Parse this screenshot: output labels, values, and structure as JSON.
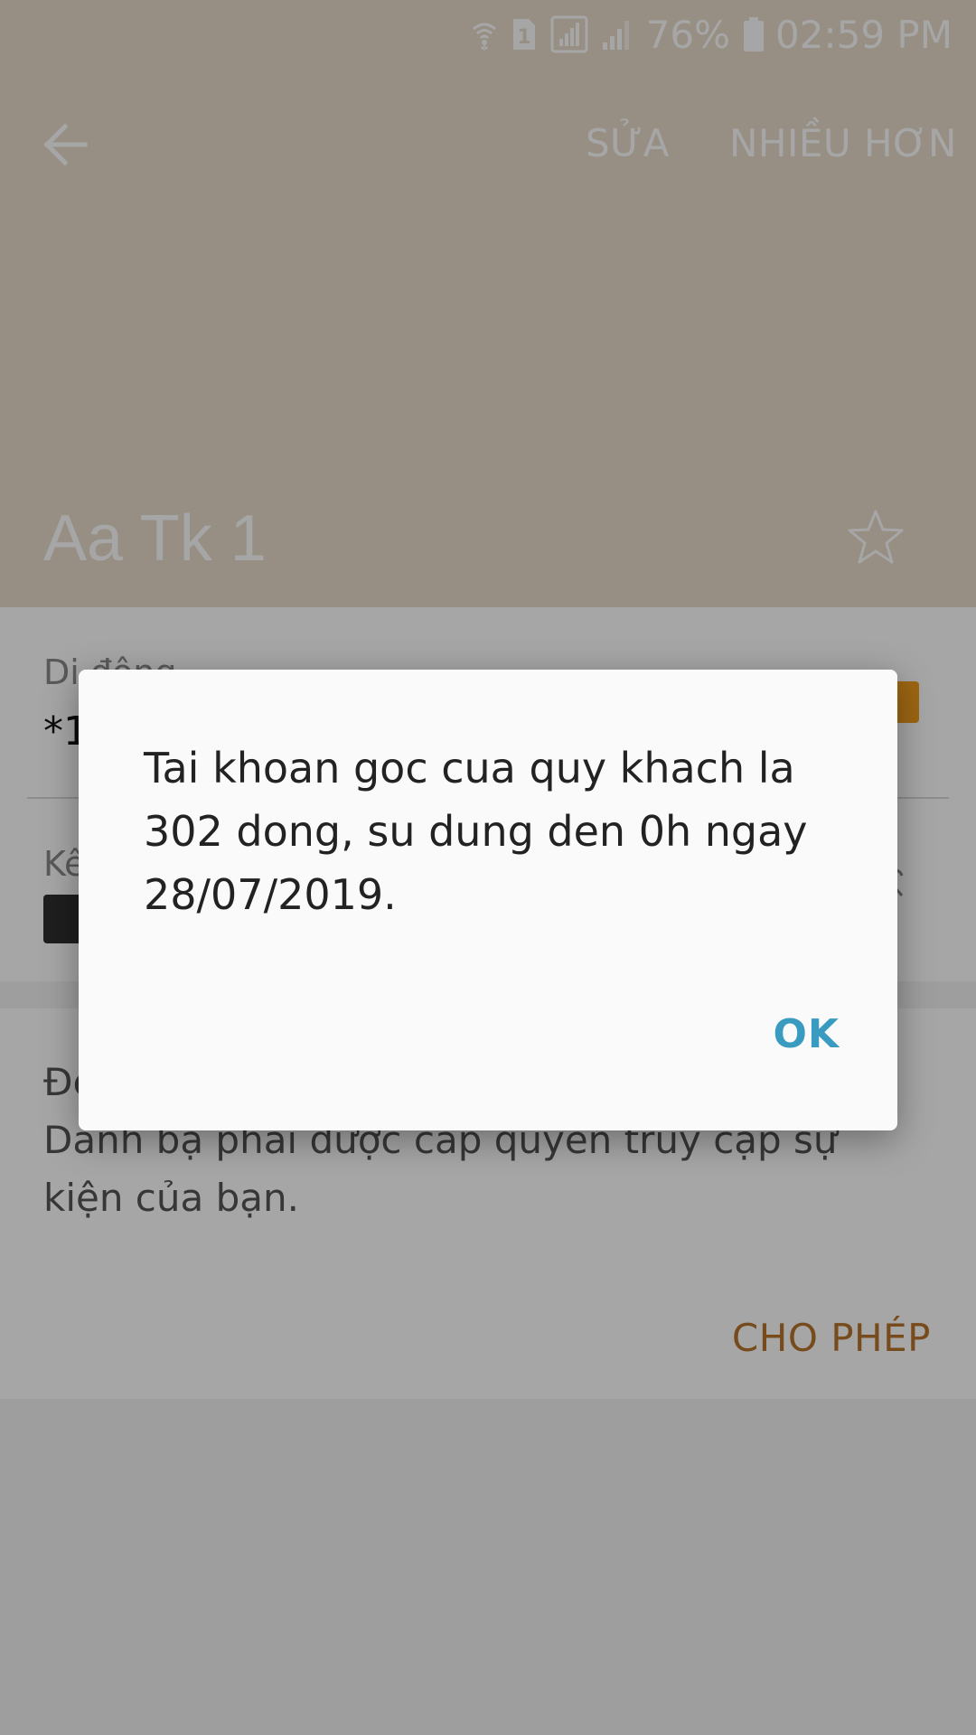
{
  "status_bar": {
    "battery_percent": "76%",
    "time": "02:59 PM",
    "sim_label": "1",
    "icons": [
      "wifi-icon",
      "sim-icon",
      "signal-icon",
      "signal-icon",
      "battery-icon"
    ]
  },
  "toolbar": {
    "back_icon": "arrow-left-icon",
    "edit_label": "SỬA",
    "more_label": "NHIỀU HƠN"
  },
  "contact": {
    "name": "Aa Tk 1",
    "favorite_icon": "star-outline-icon"
  },
  "phone_section": {
    "label": "Di động",
    "number": "*1",
    "action_icon": "message-icon"
  },
  "connection_section": {
    "label": "Kê",
    "icon": "device-icon",
    "secondary_icon": "heart-icon"
  },
  "permission_card": {
    "text": "Để ... bạn và danh bạ của bạn, ứng dụng Danh bạ phải được cấp quyền truy cập sự kiện của bạn.",
    "allow_label": "CHO PHÉP"
  },
  "dialog": {
    "message": "Tai khoan goc cua quy khach la 302 dong, su dung den 0h ngay 28/07/2019.",
    "ok_label": "OK"
  },
  "colors": {
    "header_bg": "#e8dccb",
    "dialog_ok": "#3a9bc1",
    "allow": "#b8732d",
    "phone_action": "#f29d1d"
  }
}
